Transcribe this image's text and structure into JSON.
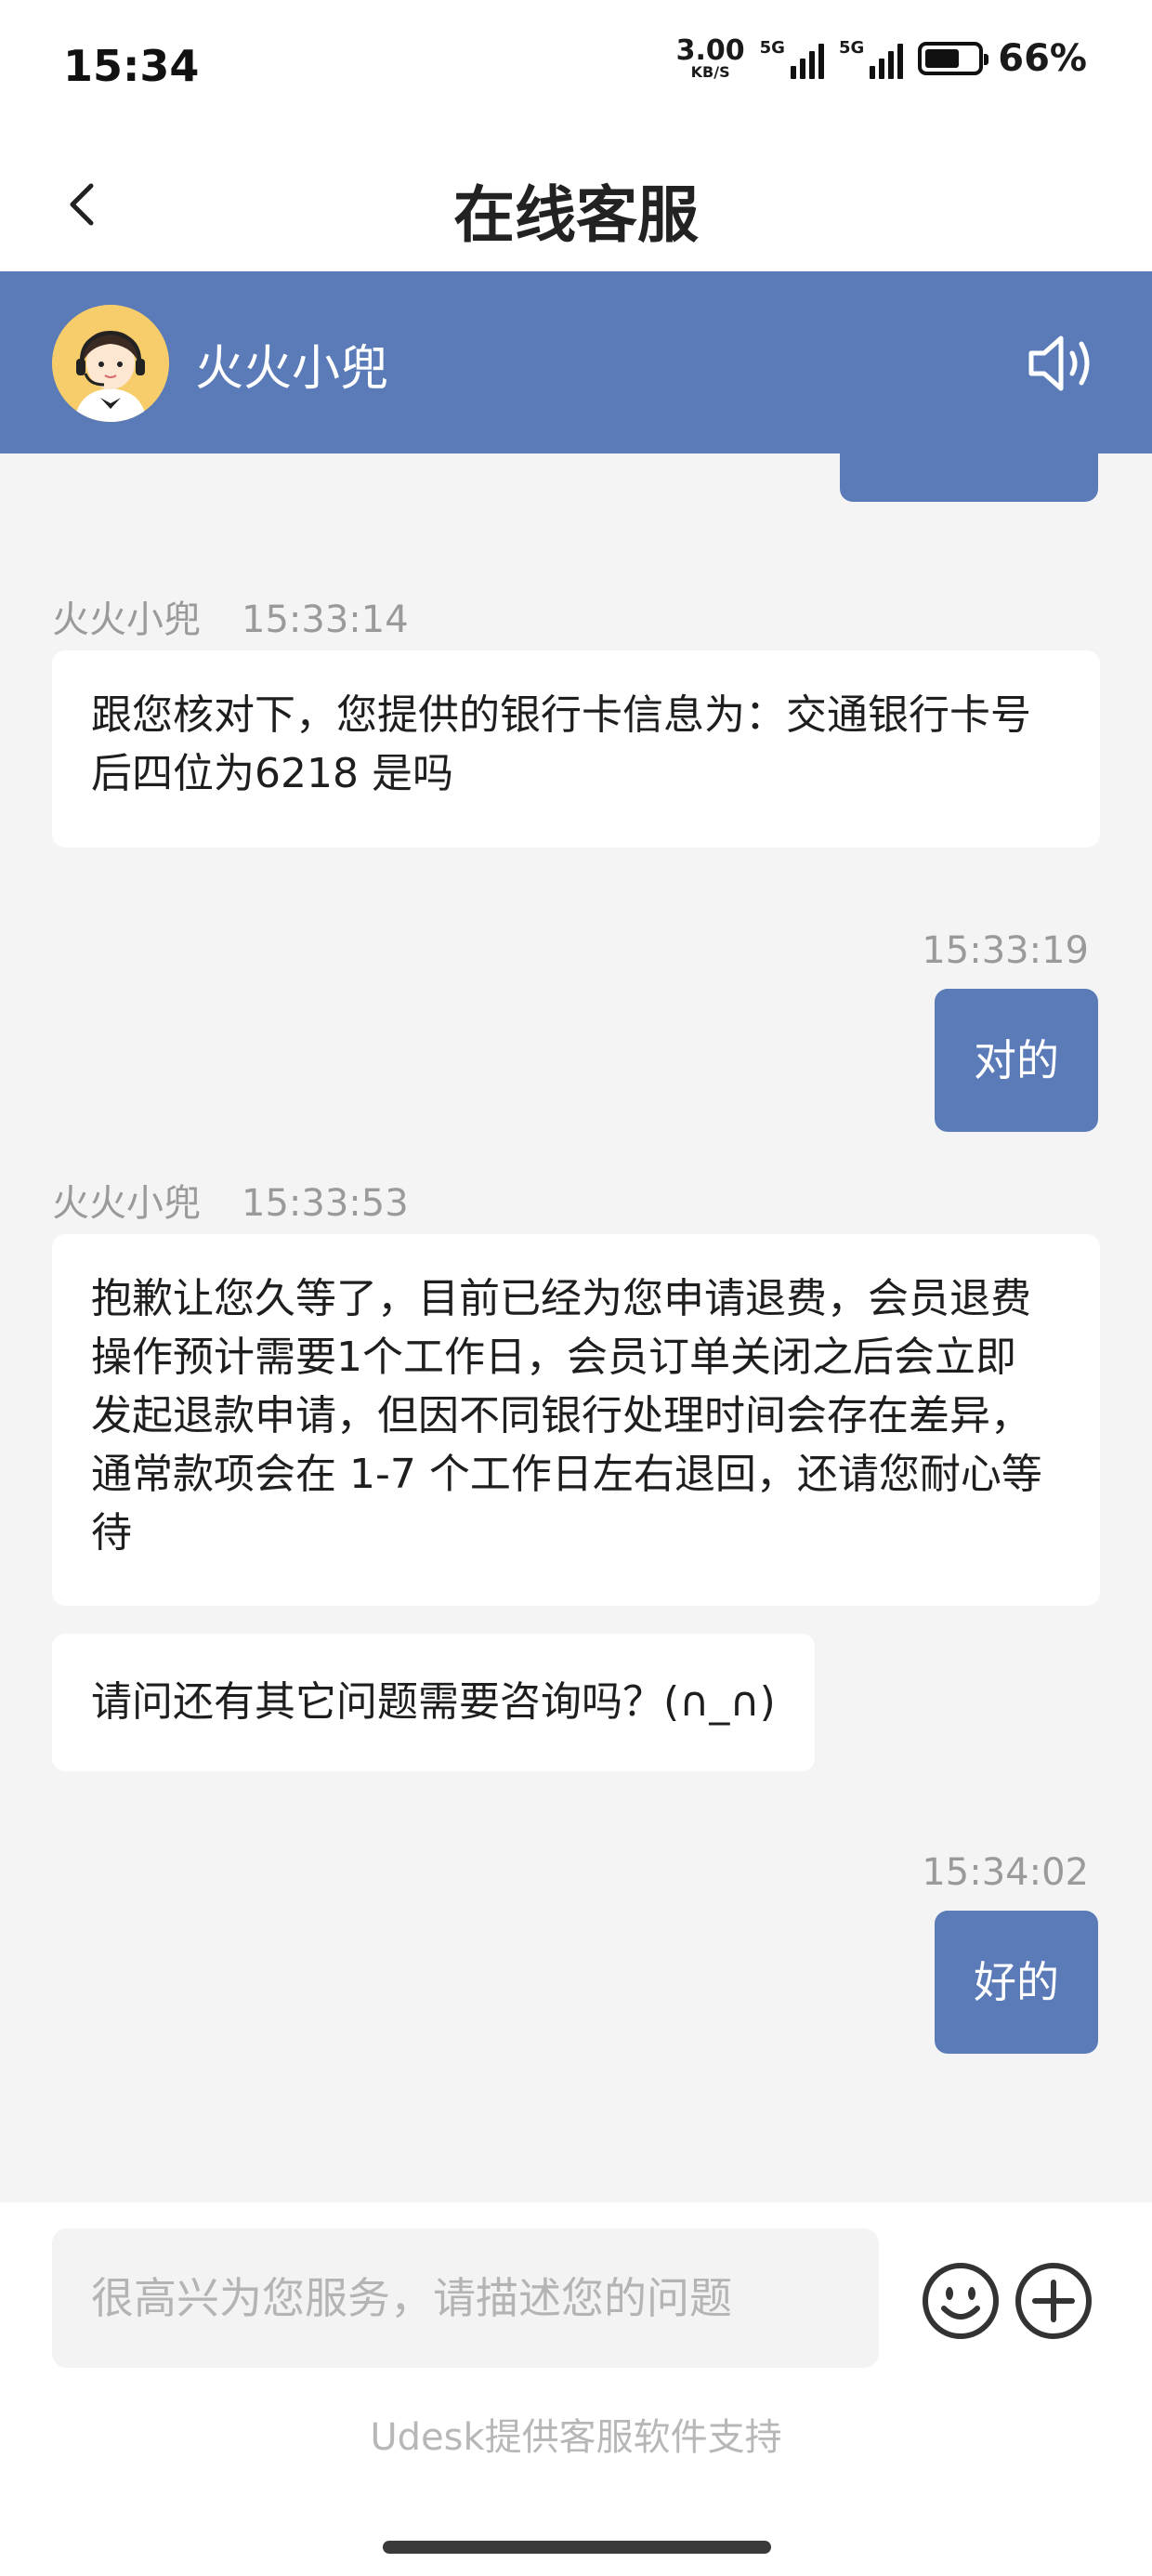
{
  "status_bar": {
    "time": "15:34",
    "net_speed": "3.00",
    "net_unit": "KB/S",
    "sim1": "5G",
    "sim2": "5G",
    "battery_percent": "66%",
    "battery_level": 0.66
  },
  "header": {
    "title": "在线客服"
  },
  "agent": {
    "name": "火火小兜"
  },
  "messages": [
    {
      "sender": "agent",
      "name": "火火小兜",
      "time": "15:33:14",
      "lines": [
        "跟您核对下，您提供的银行卡信息为：交通银行卡号",
        "后四位为6218 是吗"
      ]
    },
    {
      "sender": "user",
      "time": "15:33:19",
      "text": "对的"
    },
    {
      "sender": "agent",
      "name": "火火小兜",
      "time": "15:33:53",
      "lines": [
        "抱歉让您久等了，目前已经为您申请退费，会员退费",
        "操作预计需要1个工作日，会员订单关闭之后会立即",
        "发起退款申请，但因不同银行处理时间会存在差异，",
        "通常款项会在 1-7 个工作日左右退回，还请您耐心等",
        "待"
      ]
    },
    {
      "sender": "agent",
      "lines": [
        "请问还有其它问题需要咨询吗？(∩_∩)"
      ]
    },
    {
      "sender": "user",
      "time": "15:34:02",
      "text": "好的"
    }
  ],
  "input": {
    "placeholder": "很高兴为您服务，请描述您的问题"
  },
  "footer": {
    "powered_by": "Udesk提供客服软件支持"
  },
  "colors": {
    "accent": "#5b7bb8",
    "background": "#f4f4f4",
    "meta_text": "#9a9a9a"
  },
  "icons": [
    "back-arrow-icon",
    "speaker-icon",
    "emoji-icon",
    "plus-icon"
  ]
}
